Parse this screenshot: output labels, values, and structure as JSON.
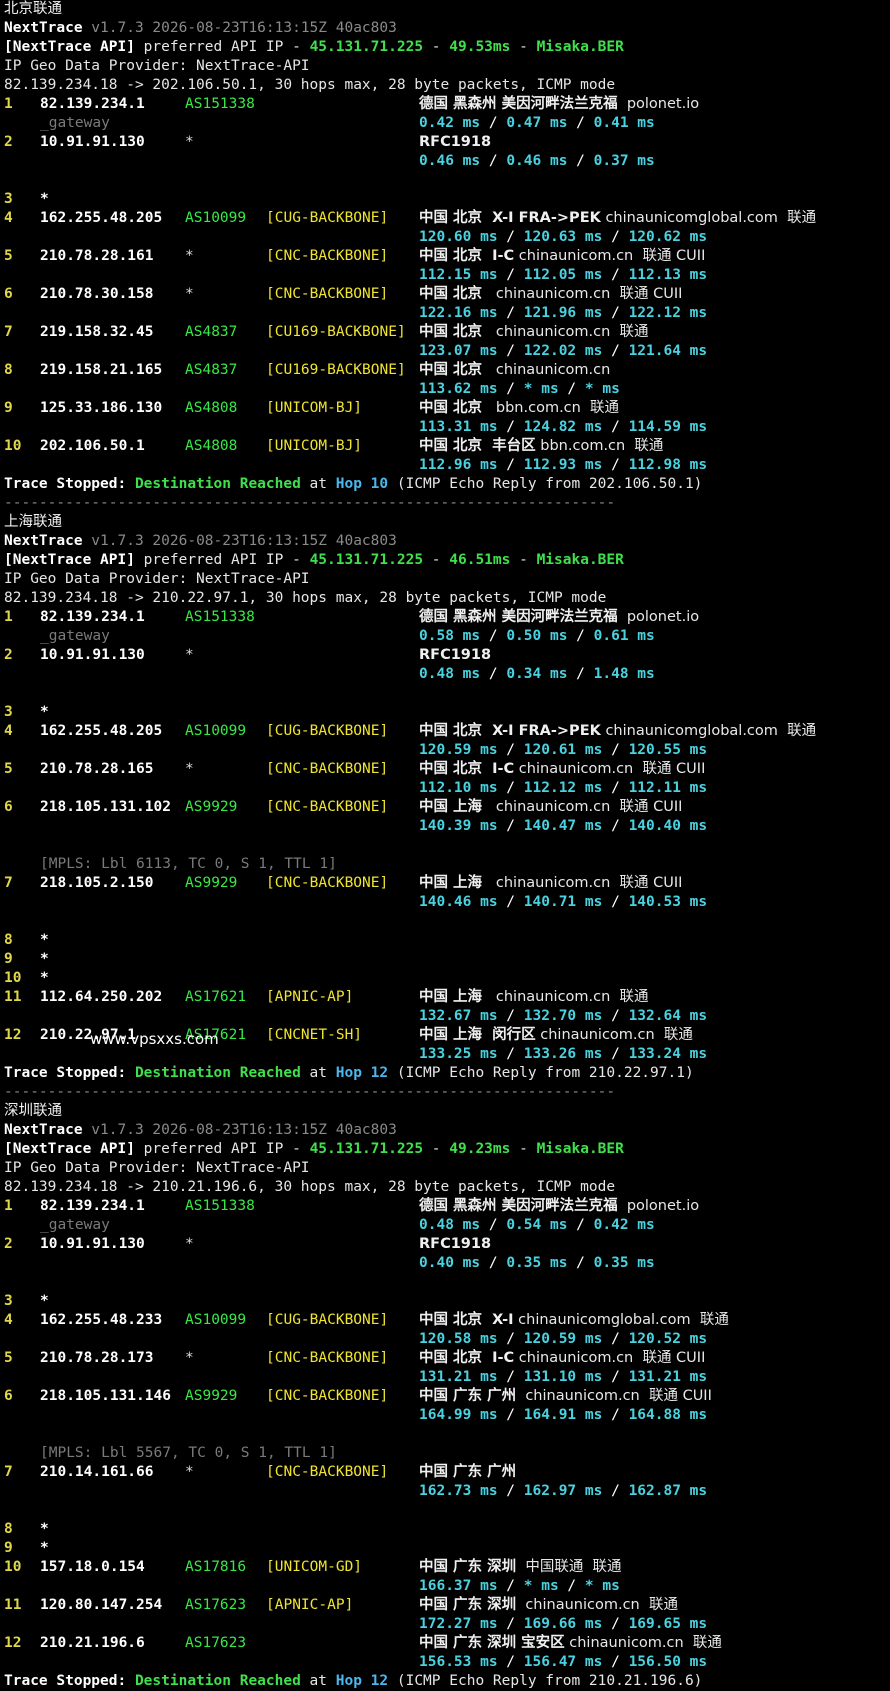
{
  "watermark": "www.vpsxxs.com",
  "colors": {
    "background": "#000000",
    "hop": "#e0d84a",
    "asn": "#38e848",
    "tag": "#f0e430",
    "rtt": "#4ad2e0",
    "green": "#3fe04c",
    "blue": "#4ab8ee"
  },
  "separator": "----------------------------------------------------------------------",
  "sections": [
    {
      "title": "北京联通",
      "version_line": {
        "name": "NextTrace",
        "rest": " v1.7.3 2026-08-23T16:13:15Z 40ac803"
      },
      "api_line": {
        "label": "[NextTrace API]",
        "text1": " preferred API IP - ",
        "ip": "45.131.71.225",
        "sep1": " - ",
        "ms": "49.53ms",
        "sep2": " - ",
        "node": "Misaka.BER"
      },
      "geo_provider": "IP Geo Data Provider: NextTrace-API",
      "route": "82.139.234.18 -> 202.106.50.1, 30 hops max, 28 byte packets, ICMP mode",
      "hops": [
        {
          "n": "1",
          "ip": "82.139.234.1",
          "as": "AS151338",
          "tag": "",
          "geo": "德国 黑森州 美因河畔法兰克福",
          "geo_rest": "  polonet.io",
          "rtt": [
            "0.42 ms",
            "0.47 ms",
            "0.41 ms"
          ],
          "sub": "_gateway",
          "sub_pos": "after_geo"
        },
        {
          "n": "2",
          "ip": "10.91.91.130",
          "as": "*",
          "tag": "",
          "geo": "RFC1918",
          "geo_rest": "",
          "rtt": [
            "0.46 ms",
            "0.46 ms",
            "0.37 ms"
          ]
        },
        {
          "n": "3",
          "ip": "*",
          "as": "",
          "tag": "",
          "geo": "",
          "geo_rest": "",
          "rtt": [],
          "blank_before": true
        },
        {
          "n": "4",
          "ip": "162.255.48.205",
          "as": "AS10099",
          "tag": "[CUG-BACKBONE]",
          "geo": "中国 北京  X-I FRA->PEK",
          "geo_rest": " chinaunicomglobal.com  联通",
          "rtt": [
            "120.60 ms",
            "120.63 ms",
            "120.62 ms"
          ]
        },
        {
          "n": "5",
          "ip": "210.78.28.161",
          "as": "*",
          "tag": "[CNC-BACKBONE]",
          "geo": "中国 北京  I-C",
          "geo_rest": " chinaunicom.cn  联通 CUII",
          "rtt": [
            "112.15 ms",
            "112.05 ms",
            "112.13 ms"
          ]
        },
        {
          "n": "6",
          "ip": "210.78.30.158",
          "as": "*",
          "tag": "[CNC-BACKBONE]",
          "geo": "中国 北京",
          "geo_rest": "   chinaunicom.cn  联通 CUII",
          "rtt": [
            "122.16 ms",
            "121.96 ms",
            "122.12 ms"
          ]
        },
        {
          "n": "7",
          "ip": "219.158.32.45",
          "as": "AS4837",
          "tag": "[CU169-BACKBONE]",
          "geo": "中国 北京",
          "geo_rest": "   chinaunicom.cn  联通",
          "rtt": [
            "123.07 ms",
            "122.02 ms",
            "121.64 ms"
          ]
        },
        {
          "n": "8",
          "ip": "219.158.21.165",
          "as": "AS4837",
          "tag": "[CU169-BACKBONE]",
          "geo": "中国 北京",
          "geo_rest": "   chinaunicom.cn",
          "rtt": [
            "113.62 ms",
            "* ms",
            "* ms"
          ]
        },
        {
          "n": "9",
          "ip": "125.33.186.130",
          "as": "AS4808",
          "tag": "[UNICOM-BJ]",
          "geo": "中国 北京",
          "geo_rest": "   bbn.com.cn  联通",
          "rtt": [
            "113.31 ms",
            "124.82 ms",
            "114.59 ms"
          ]
        },
        {
          "n": "10",
          "ip": "202.106.50.1",
          "as": "AS4808",
          "tag": "[UNICOM-BJ]",
          "geo": "中国 北京  丰台区",
          "geo_rest": " bbn.com.cn  联通",
          "rtt": [
            "112.96 ms",
            "112.93 ms",
            "112.98 ms"
          ]
        }
      ],
      "stop": {
        "label": "Trace Stopped:",
        "dest": "Destination Reached",
        "at": " at ",
        "hop": "Hop 10",
        "rest": " (ICMP Echo Reply from 202.106.50.1)"
      }
    },
    {
      "title": "上海联通",
      "version_line": {
        "name": "NextTrace",
        "rest": " v1.7.3 2026-08-23T16:13:15Z 40ac803"
      },
      "api_line": {
        "label": "[NextTrace API]",
        "text1": " preferred API IP - ",
        "ip": "45.131.71.225",
        "sep1": " - ",
        "ms": "46.51ms",
        "sep2": " - ",
        "node": "Misaka.BER"
      },
      "geo_provider": "IP Geo Data Provider: NextTrace-API",
      "route": "82.139.234.18 -> 210.22.97.1, 30 hops max, 28 byte packets, ICMP mode",
      "hops": [
        {
          "n": "1",
          "ip": "82.139.234.1",
          "as": "AS151338",
          "tag": "",
          "geo": "德国 黑森州 美因河畔法兰克福",
          "geo_rest": "  polonet.io",
          "rtt": [
            "0.58 ms",
            "0.50 ms",
            "0.61 ms"
          ],
          "sub": "_gateway"
        },
        {
          "n": "2",
          "ip": "10.91.91.130",
          "as": "*",
          "tag": "",
          "geo": "RFC1918",
          "geo_rest": "",
          "rtt": [
            "0.48 ms",
            "0.34 ms",
            "1.48 ms"
          ]
        },
        {
          "n": "3",
          "ip": "*",
          "as": "",
          "tag": "",
          "geo": "",
          "geo_rest": "",
          "rtt": [],
          "blank_before": true
        },
        {
          "n": "4",
          "ip": "162.255.48.205",
          "as": "AS10099",
          "tag": "[CUG-BACKBONE]",
          "geo": "中国 北京  X-I FRA->PEK",
          "geo_rest": " chinaunicomglobal.com  联通",
          "rtt": [
            "120.59 ms",
            "120.61 ms",
            "120.55 ms"
          ]
        },
        {
          "n": "5",
          "ip": "210.78.28.165",
          "as": "*",
          "tag": "[CNC-BACKBONE]",
          "geo": "中国 北京  I-C",
          "geo_rest": " chinaunicom.cn  联通 CUII",
          "rtt": [
            "112.10 ms",
            "112.12 ms",
            "112.11 ms"
          ]
        },
        {
          "n": "6",
          "ip": "218.105.131.102",
          "as": "AS9929",
          "tag": "[CNC-BACKBONE]",
          "geo": "中国 上海",
          "geo_rest": "   chinaunicom.cn  联通 CUII",
          "rtt": [
            "140.39 ms",
            "140.47 ms",
            "140.40 ms"
          ],
          "mpls": "[MPLS: Lbl 6113, TC 0, S 1, TTL 1]"
        },
        {
          "n": "7",
          "ip": "218.105.2.150",
          "as": "AS9929",
          "tag": "[CNC-BACKBONE]",
          "geo": "中国 上海",
          "geo_rest": "   chinaunicom.cn  联通 CUII",
          "rtt": [
            "140.46 ms",
            "140.71 ms",
            "140.53 ms"
          ]
        },
        {
          "n": "8",
          "ip": "*",
          "as": "",
          "tag": "",
          "geo": "",
          "geo_rest": "",
          "rtt": [],
          "blank_before": true
        },
        {
          "n": "9",
          "ip": "*",
          "as": "",
          "tag": "",
          "geo": "",
          "geo_rest": "",
          "rtt": []
        },
        {
          "n": "10",
          "ip": "*",
          "as": "",
          "tag": "",
          "geo": "",
          "geo_rest": "",
          "rtt": []
        },
        {
          "n": "11",
          "ip": "112.64.250.202",
          "as": "AS17621",
          "tag": "[APNIC-AP]",
          "geo": "中国 上海",
          "geo_rest": "   chinaunicom.cn  联通",
          "rtt": [
            "132.67 ms",
            "132.70 ms",
            "132.64 ms"
          ]
        },
        {
          "n": "12",
          "ip": "210.22.97.1",
          "as": "AS17621",
          "tag": "[CNCNET-SH]",
          "geo": "中国 上海  闵行区",
          "geo_rest": " chinaunicom.cn  联通",
          "rtt": [
            "133.25 ms",
            "133.26 ms",
            "133.24 ms"
          ]
        }
      ],
      "stop": {
        "label": "Trace Stopped:",
        "dest": "Destination Reached",
        "at": " at ",
        "hop": "Hop 12",
        "rest": " (ICMP Echo Reply from 210.22.97.1)"
      }
    },
    {
      "title": "深圳联通",
      "version_line": {
        "name": "NextTrace",
        "rest": " v1.7.3 2026-08-23T16:13:15Z 40ac803"
      },
      "api_line": {
        "label": "[NextTrace API]",
        "text1": " preferred API IP - ",
        "ip": "45.131.71.225",
        "sep1": " - ",
        "ms": "49.23ms",
        "sep2": " - ",
        "node": "Misaka.BER"
      },
      "geo_provider": "IP Geo Data Provider: NextTrace-API",
      "route": "82.139.234.18 -> 210.21.196.6, 30 hops max, 28 byte packets, ICMP mode",
      "hops": [
        {
          "n": "1",
          "ip": "82.139.234.1",
          "as": "AS151338",
          "tag": "",
          "geo": "德国 黑森州 美因河畔法兰克福",
          "geo_rest": "  polonet.io",
          "rtt": [
            "0.48 ms",
            "0.54 ms",
            "0.42 ms"
          ],
          "sub": "_gateway"
        },
        {
          "n": "2",
          "ip": "10.91.91.130",
          "as": "*",
          "tag": "",
          "geo": "RFC1918",
          "geo_rest": "",
          "rtt": [
            "0.40 ms",
            "0.35 ms",
            "0.35 ms"
          ]
        },
        {
          "n": "3",
          "ip": "*",
          "as": "",
          "tag": "",
          "geo": "",
          "geo_rest": "",
          "rtt": [],
          "blank_before": true
        },
        {
          "n": "4",
          "ip": "162.255.48.233",
          "as": "AS10099",
          "tag": "[CUG-BACKBONE]",
          "geo": "中国 北京  X-I",
          "geo_rest": " chinaunicomglobal.com  联通",
          "rtt": [
            "120.58 ms",
            "120.59 ms",
            "120.52 ms"
          ]
        },
        {
          "n": "5",
          "ip": "210.78.28.173",
          "as": "*",
          "tag": "[CNC-BACKBONE]",
          "geo": "中国 北京  I-C",
          "geo_rest": " chinaunicom.cn  联通 CUII",
          "rtt": [
            "131.21 ms",
            "131.10 ms",
            "131.21 ms"
          ]
        },
        {
          "n": "6",
          "ip": "218.105.131.146",
          "as": "AS9929",
          "tag": "[CNC-BACKBONE]",
          "geo": "中国 广东 广州",
          "geo_rest": "  chinaunicom.cn  联通 CUII",
          "rtt": [
            "164.99 ms",
            "164.91 ms",
            "164.88 ms"
          ],
          "mpls": "[MPLS: Lbl 5567, TC 0, S 1, TTL 1]"
        },
        {
          "n": "7",
          "ip": "210.14.161.66",
          "as": "*",
          "tag": "[CNC-BACKBONE]",
          "geo": "中国 广东 广州",
          "geo_rest": "",
          "rtt": [
            "162.73 ms",
            "162.97 ms",
            "162.87 ms"
          ]
        },
        {
          "n": "8",
          "ip": "*",
          "as": "",
          "tag": "",
          "geo": "",
          "geo_rest": "",
          "rtt": [],
          "blank_before": true
        },
        {
          "n": "9",
          "ip": "*",
          "as": "",
          "tag": "",
          "geo": "",
          "geo_rest": "",
          "rtt": []
        },
        {
          "n": "10",
          "ip": "157.18.0.154",
          "as": "AS17816",
          "tag": "[UNICOM-GD]",
          "geo": "中国 广东 深圳",
          "geo_rest": "  中国联通  联通",
          "rtt": [
            "166.37 ms",
            "* ms",
            "* ms"
          ]
        },
        {
          "n": "11",
          "ip": "120.80.147.254",
          "as": "AS17623",
          "tag": "[APNIC-AP]",
          "geo": "中国 广东 深圳",
          "geo_rest": "  chinaunicom.cn  联通",
          "rtt": [
            "172.27 ms",
            "169.66 ms",
            "169.65 ms"
          ]
        },
        {
          "n": "12",
          "ip": "210.21.196.6",
          "as": "AS17623",
          "tag": "",
          "geo": "中国 广东 深圳 宝安区",
          "geo_rest": " chinaunicom.cn  联通",
          "rtt": [
            "156.53 ms",
            "156.47 ms",
            "156.50 ms"
          ]
        }
      ],
      "stop": {
        "label": "Trace Stopped:",
        "dest": "Destination Reached",
        "at": " at ",
        "hop": "Hop 12",
        "rest": " (ICMP Echo Reply from 210.21.196.6)"
      }
    }
  ]
}
